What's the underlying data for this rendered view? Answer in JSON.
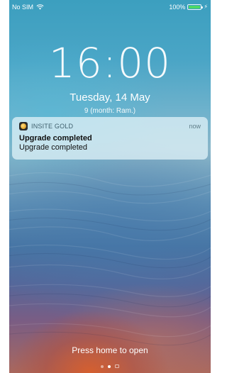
{
  "status_bar": {
    "carrier": "No SIM",
    "battery_percent": "100%",
    "battery_color": "#4cd964"
  },
  "lock_screen": {
    "time": "16:00",
    "date": "Tuesday, 14 May",
    "secondary_date": "9 (month: Ram.)",
    "unlock_hint": "Press home to open"
  },
  "notification": {
    "app_name": "INSITE GOLD",
    "time": "now",
    "title": "Upgrade completed",
    "body": "Upgrade completed",
    "app_icon": "insite-gold-app-icon"
  },
  "page_indicator": {
    "pages": 3,
    "active_index": 1,
    "last_icon": "camera-icon"
  }
}
